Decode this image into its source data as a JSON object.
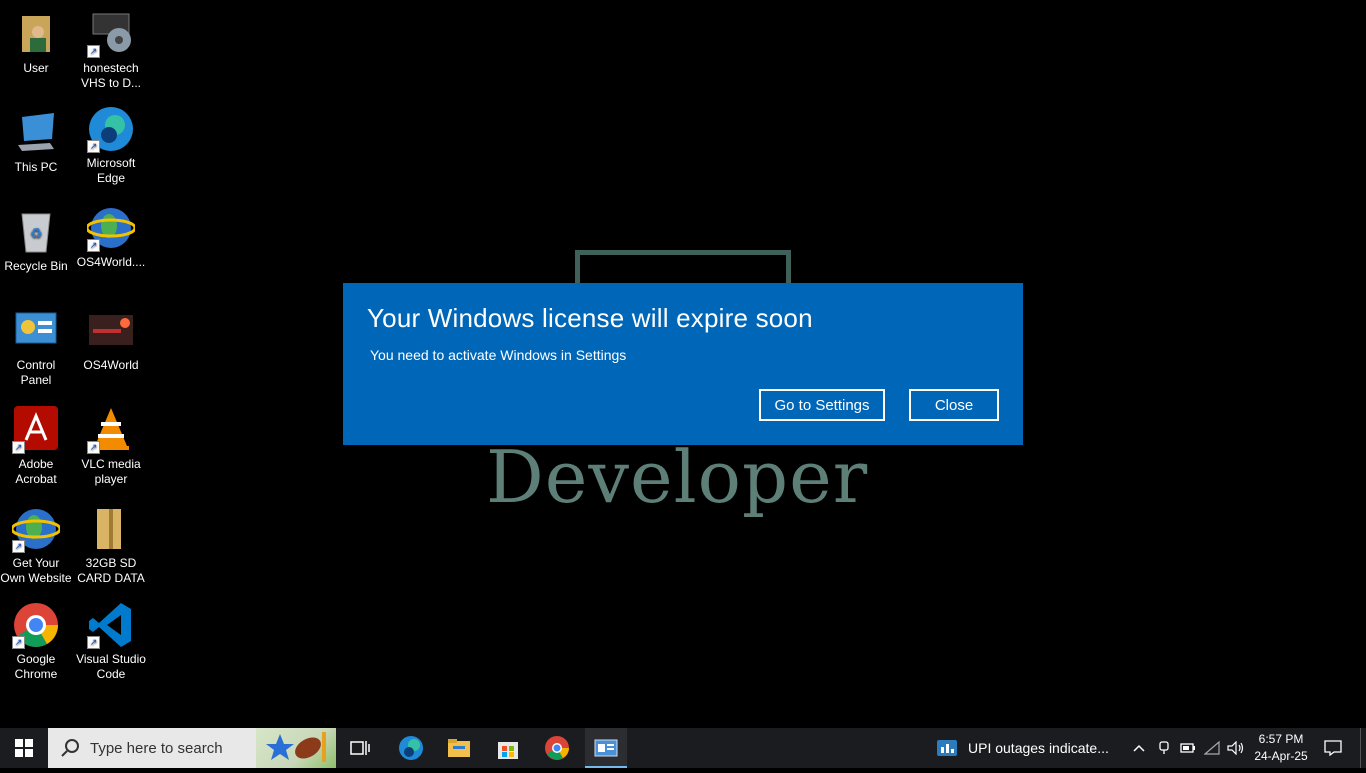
{
  "desktop": {
    "wallpaper_text": "Developer",
    "icons": [
      {
        "label": "User",
        "icon": "user-folder-icon"
      },
      {
        "label": "honestech VHS to D...",
        "icon": "vhs-app-icon"
      },
      {
        "label": "This PC",
        "icon": "this-pc-icon"
      },
      {
        "label": "Microsoft Edge",
        "icon": "edge-icon"
      },
      {
        "label": "Recycle Bin",
        "icon": "recycle-bin-icon"
      },
      {
        "label": "OS4World....",
        "icon": "internet-globe-icon"
      },
      {
        "label": "Control Panel",
        "icon": "control-panel-icon"
      },
      {
        "label": "OS4World",
        "icon": "os4world-icon"
      },
      {
        "label": "Adobe Acrobat",
        "icon": "adobe-acrobat-icon"
      },
      {
        "label": "VLC media player",
        "icon": "vlc-icon"
      },
      {
        "label": "Get Your Own Website",
        "icon": "internet-globe-icon"
      },
      {
        "label": "32GB SD CARD DATA",
        "icon": "folder-icon"
      },
      {
        "label": "Google Chrome",
        "icon": "chrome-icon"
      },
      {
        "label": "Visual Studio Code",
        "icon": "vscode-icon"
      }
    ]
  },
  "dialog": {
    "title": "Your Windows license will expire soon",
    "message": "You need to activate Windows in Settings",
    "settings_button": "Go to Settings",
    "close_button": "Close",
    "background": "#0067b8"
  },
  "taskbar": {
    "search_placeholder": "Type here to search",
    "news_text": "UPI outages indicate...",
    "time": "6:57 PM",
    "date": "24-Apr-25",
    "accent": "#76b9ed"
  }
}
